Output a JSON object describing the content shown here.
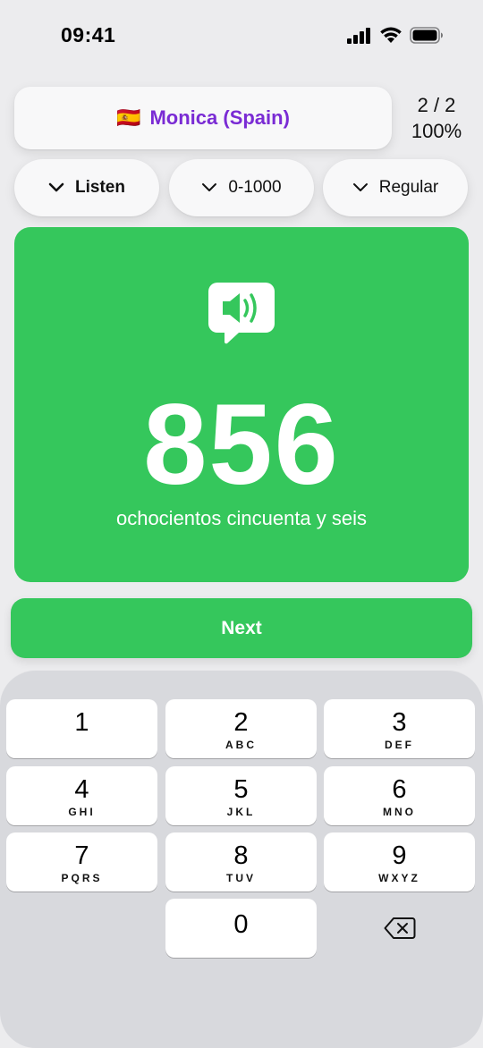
{
  "status": {
    "time": "09:41"
  },
  "voice": {
    "flag": "🇪🇸",
    "name": "Monica (Spain)"
  },
  "score": {
    "count": "2 / 2",
    "percent": "100%"
  },
  "filters": {
    "mode": "Listen",
    "range": "0-1000",
    "speed": "Regular"
  },
  "card": {
    "number": "856",
    "words": "ochocientos cincuenta y seis",
    "color": "#35c75c",
    "icon": "speaker-bubble-icon"
  },
  "next_label": "Next",
  "keypad": {
    "keys": [
      {
        "digit": "1",
        "letters": ""
      },
      {
        "digit": "2",
        "letters": "ABC"
      },
      {
        "digit": "3",
        "letters": "DEF"
      },
      {
        "digit": "4",
        "letters": "GHI"
      },
      {
        "digit": "5",
        "letters": "JKL"
      },
      {
        "digit": "6",
        "letters": "MNO"
      },
      {
        "digit": "7",
        "letters": "PQRS"
      },
      {
        "digit": "8",
        "letters": "TUV"
      },
      {
        "digit": "9",
        "letters": "WXYZ"
      },
      {
        "digit": "0",
        "letters": ""
      }
    ],
    "backspace_icon": "backspace-icon"
  },
  "colors": {
    "accent": "#35c75c",
    "voice_text": "#7a2bd4"
  }
}
